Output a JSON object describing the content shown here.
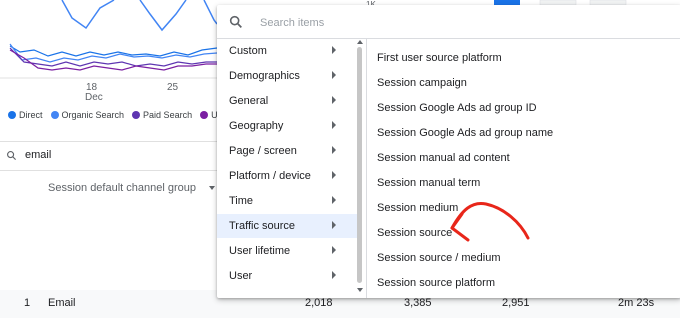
{
  "background": {
    "axis_marker": "1K",
    "x_ticks": [
      {
        "day": "18",
        "month": "Dec"
      },
      {
        "day": "25",
        "month": ""
      }
    ],
    "legend": [
      {
        "label": "Direct",
        "color": "#1a73e8"
      },
      {
        "label": "Organic Search",
        "color": "#4285f4"
      },
      {
        "label": "Paid Search",
        "color": "#5e35b1"
      },
      {
        "label": "Un",
        "color": "#7b1fa2"
      }
    ],
    "table_search": {
      "icon": "search-icon",
      "value": "email"
    },
    "column_header": {
      "label": "Session default channel group",
      "icon": "caret-down-icon"
    },
    "bottom_row": {
      "rank": "1",
      "channel": "Email",
      "values": [
        "2,018",
        "3,385",
        "2,951",
        "2m 23s"
      ]
    }
  },
  "dropdown": {
    "search": {
      "icon": "search-icon",
      "placeholder": "Search items",
      "value": ""
    },
    "categories": [
      {
        "label": "Custom",
        "active": false
      },
      {
        "label": "Demographics",
        "active": false
      },
      {
        "label": "General",
        "active": false
      },
      {
        "label": "Geography",
        "active": false
      },
      {
        "label": "Page / screen",
        "active": false
      },
      {
        "label": "Platform / device",
        "active": false
      },
      {
        "label": "Time",
        "active": false
      },
      {
        "label": "Traffic source",
        "active": true
      },
      {
        "label": "User lifetime",
        "active": false
      },
      {
        "label": "User",
        "active": false
      }
    ],
    "options": [
      {
        "label": "First user source platform"
      },
      {
        "label": "Session campaign"
      },
      {
        "label": "Session Google Ads ad group ID"
      },
      {
        "label": "Session Google Ads ad group name"
      },
      {
        "label": "Session manual ad content"
      },
      {
        "label": "Session manual term"
      },
      {
        "label": "Session medium"
      },
      {
        "label": "Session source",
        "highlighted_by_annotation": true
      },
      {
        "label": "Session source / medium"
      },
      {
        "label": "Session source platform"
      }
    ],
    "annotation": {
      "type": "arrow",
      "color": "#e8261a",
      "points_to": "Session source"
    }
  }
}
